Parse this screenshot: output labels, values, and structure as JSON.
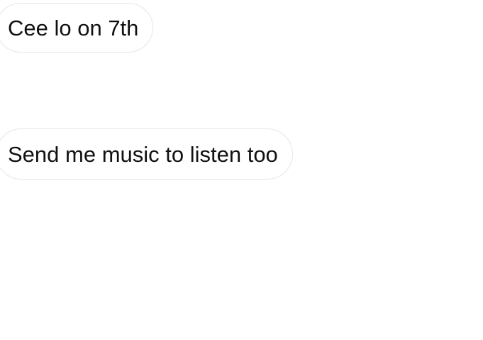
{
  "messages": [
    {
      "text": "Cee lo on 7th"
    },
    {
      "text": "Send me music to listen too"
    }
  ],
  "colors": {
    "background": "#ffffff",
    "bubble_background": "#ffffff",
    "bubble_border": "#e6e6e6",
    "text": "#111111"
  }
}
